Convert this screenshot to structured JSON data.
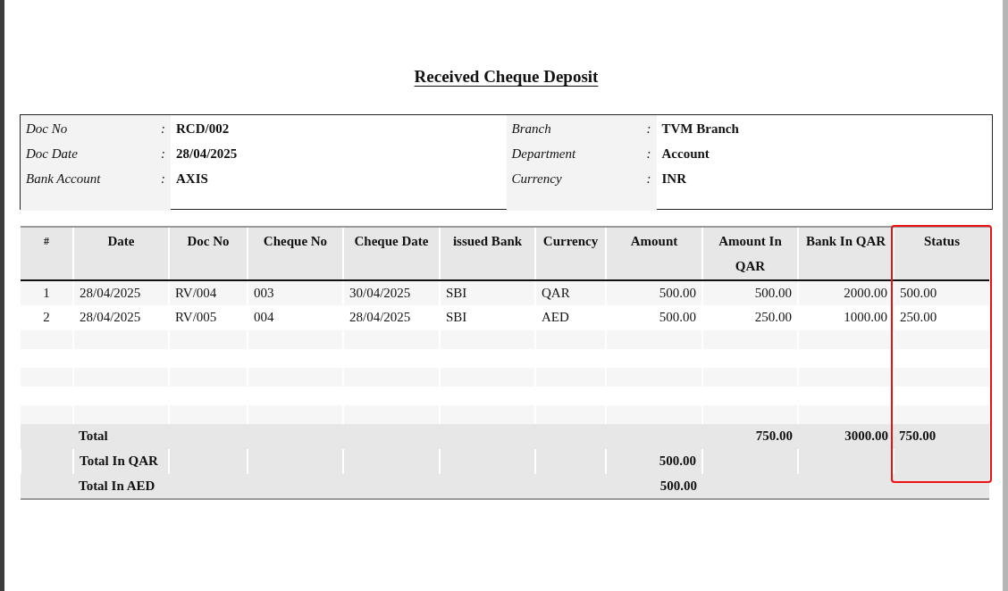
{
  "title": "Received Cheque Deposit",
  "header_fields": [
    {
      "label": "Doc No",
      "value": "RCD/002",
      "colon": ":"
    },
    {
      "label": "Branch",
      "value": "TVM Branch",
      "colon": ":"
    },
    {
      "label": "Doc Date",
      "value": "28/04/2025",
      "colon": ":"
    },
    {
      "label": "Department",
      "value": "Account",
      "colon": ":"
    },
    {
      "label": "Bank Account",
      "value": "AXIS",
      "colon": ":"
    },
    {
      "label": "Currency",
      "value": "INR",
      "colon": ":"
    }
  ],
  "table": {
    "columns": [
      {
        "label": "#"
      },
      {
        "label": "Date"
      },
      {
        "label": "Doc No"
      },
      {
        "label": "Cheque No"
      },
      {
        "label": "Cheque Date"
      },
      {
        "label": "issued Bank"
      },
      {
        "label": "Currency"
      },
      {
        "label": "Amount"
      },
      {
        "label": "Amount In QAR"
      },
      {
        "label": "Bank In QAR"
      },
      {
        "label": "Status",
        "highlighted": true
      }
    ],
    "rows": [
      {
        "cells": [
          "1",
          "28/04/2025",
          "RV/004",
          "003",
          "30/04/2025",
          "SBI",
          "QAR",
          "500.00",
          "500.00",
          "2000.00",
          "500.00"
        ]
      },
      {
        "cells": [
          "2",
          "28/04/2025",
          "RV/005",
          "004",
          "28/04/2025",
          "SBI",
          "AED",
          "500.00",
          "250.00",
          "1000.00",
          "250.00"
        ]
      }
    ],
    "totals": [
      {
        "label": "Total",
        "amount_in_qar": "750.00",
        "bank_in_qar": "3000.00",
        "status": "750.00"
      },
      {
        "label": "Total In QAR",
        "amount": "500.00"
      },
      {
        "label": "Total In AED",
        "amount": "500.00"
      }
    ]
  }
}
